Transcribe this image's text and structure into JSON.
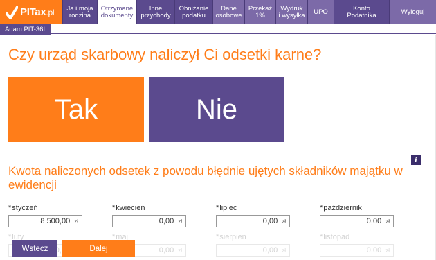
{
  "brand": {
    "name": "PITax",
    "suffix": ".pl"
  },
  "nav": {
    "items": [
      {
        "label1": "Ja i moja",
        "label2": "rodzina"
      },
      {
        "label1": "Otrzymane",
        "label2": "dokumenty"
      },
      {
        "label1": "Inne",
        "label2": "przychody"
      },
      {
        "label1": "Obniżanie",
        "label2": "podatku"
      },
      {
        "label1": "Dane",
        "label2": "osobowe"
      },
      {
        "label1": "Przekaż",
        "label2": "1%"
      },
      {
        "label1": "Wydruk",
        "label2": "i wysyłka"
      },
      {
        "label1": "UPO",
        "label2": ""
      },
      {
        "label1": "Konto",
        "label2": "Podatnika"
      },
      {
        "label1": "Wyloguj",
        "label2": ""
      }
    ]
  },
  "profile": {
    "tab_label": "Adam PIT-36L"
  },
  "question": "Czy urząd skarbowy naliczył Ci odsetki karne?",
  "answers": {
    "yes": "Tak",
    "no": "Nie"
  },
  "info_icon": "i",
  "section": {
    "title": "Kwota naliczonych odsetek z powodu błędnie ujętych składników majątku w ewidencji"
  },
  "months": [
    {
      "label": "styczeń",
      "value": "8 500,00",
      "currency": "zł"
    },
    {
      "label": "kwiecień",
      "value": "0,00",
      "currency": "zł"
    },
    {
      "label": "lipiec",
      "value": "0,00",
      "currency": "zł"
    },
    {
      "label": "październik",
      "value": "0,00",
      "currency": "zł"
    },
    {
      "label": "luty",
      "value": "0,00",
      "currency": "zł"
    },
    {
      "label": "maj",
      "value": "0,00",
      "currency": "zł"
    },
    {
      "label": "sierpień",
      "value": "0,00",
      "currency": "zł"
    },
    {
      "label": "listopad",
      "value": "0,00",
      "currency": "zł"
    }
  ],
  "footer": {
    "back": "Wstecz",
    "next": "Dalej"
  },
  "colors": {
    "orange": "#ff7d19",
    "purple": "#5b4a8e",
    "dark_purple": "#3a2d6b"
  }
}
